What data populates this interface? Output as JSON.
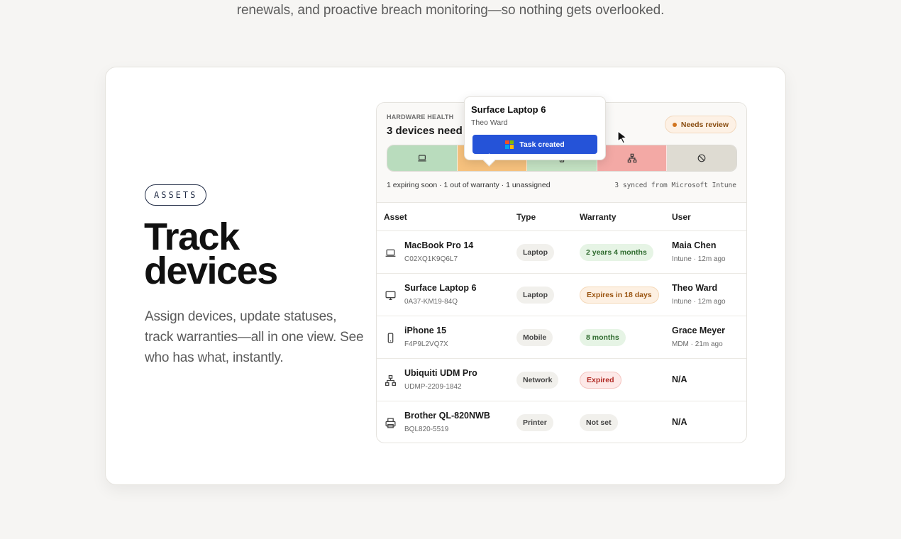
{
  "intro_text": "renewals, and proactive breach monitoring—so nothing gets overlooked.",
  "section": {
    "pill": "ASSETS",
    "headline_line1": "Track",
    "headline_line2": "devices",
    "lead": "Assign devices, update statuses, track warranties—all in one view. See who has what, instantly."
  },
  "panel": {
    "hw_label": "HARDWARE HEALTH",
    "hw_title": "3 devices need attention",
    "review_badge": "Needs review",
    "summary": "1 expiring soon · 1 out of warranty · 1 unassigned",
    "synced": "3 synced from Microsoft Intune",
    "popover": {
      "title": "Surface Laptop 6",
      "subtitle": "Theo Ward",
      "button": "Task created"
    },
    "columns": {
      "asset": "Asset",
      "type": "Type",
      "warranty": "Warranty",
      "user": "User"
    },
    "rows": [
      {
        "icon": "laptop-icon",
        "name": "MacBook Pro 14",
        "serial": "C02XQ1K9Q6L7",
        "type": "Laptop",
        "warranty": "2 years 4 months",
        "warranty_status": "green",
        "user": "Maia Chen",
        "meta": "Intune · 12m ago"
      },
      {
        "icon": "monitor-icon",
        "name": "Surface Laptop 6",
        "serial": "0A37-KM19-84Q",
        "type": "Laptop",
        "warranty": "Expires in 18 days",
        "warranty_status": "orange",
        "user": "Theo Ward",
        "meta": "Intune · 12m ago"
      },
      {
        "icon": "phone-icon",
        "name": "iPhone 15",
        "serial": "F4P9L2VQ7X",
        "type": "Mobile",
        "warranty": "8 months",
        "warranty_status": "green",
        "user": "Grace Meyer",
        "meta": "MDM · 21m ago"
      },
      {
        "icon": "network-icon",
        "name": "Ubiquiti UDM Pro",
        "serial": "UDMP-2209-1842",
        "type": "Network",
        "warranty": "Expired",
        "warranty_status": "red",
        "user": "N/A",
        "meta": ""
      },
      {
        "icon": "printer-icon",
        "name": "Brother QL-820NWB",
        "serial": "BQL820-5519",
        "type": "Printer",
        "warranty": "Not set",
        "warranty_status": "gray",
        "user": "N/A",
        "meta": ""
      }
    ]
  },
  "colors": {
    "accent": "#2553d8",
    "ok": "#b9dcbd",
    "warn": "#f6c17d",
    "bad": "#f3a9a5",
    "neutral": "#dedbd2"
  }
}
